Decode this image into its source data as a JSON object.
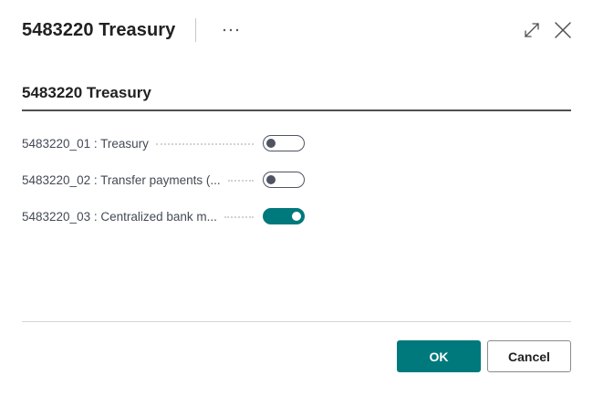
{
  "header": {
    "title": "5483220 Treasury",
    "more_icon": "more-ellipsis-icon",
    "expand_icon": "expand-icon",
    "close_icon": "close-icon"
  },
  "section": {
    "title": "5483220 Treasury"
  },
  "fields": [
    {
      "label": "5483220_01 : Treasury",
      "enabled": false
    },
    {
      "label": "5483220_02 : Transfer payments (...",
      "enabled": false
    },
    {
      "label": "5483220_03 : Centralized bank m...",
      "enabled": true
    }
  ],
  "footer": {
    "ok_label": "OK",
    "cancel_label": "Cancel"
  },
  "colors": {
    "accent": "#00797c",
    "toggle_off": "#505462",
    "text": "#212121"
  }
}
